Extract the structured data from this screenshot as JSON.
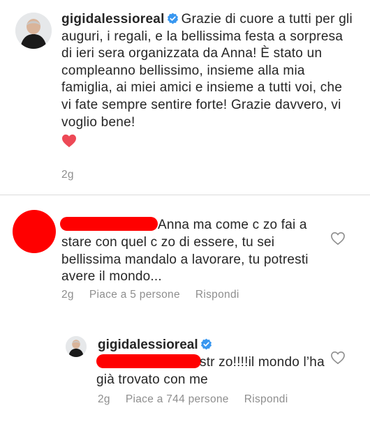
{
  "post": {
    "username": "gigidalessioreal",
    "caption": "Grazie di cuore a tutti per gli auguri, i regali, e la bellissima festa a sorpresa di ieri sera organizzata da Anna! È stato un compleanno bellissimo, insieme alla mia famiglia, ai miei amici e insieme a tutti voi, che vi fate sempre sentire forte! Grazie davvero, vi voglio bene!",
    "heart_emoji": "red-heart-icon",
    "time": "2g"
  },
  "comments": [
    {
      "text": "Anna ma come c    zo fai a stare con quel c    zo di essere, tu sei bellissima mandalo a lavorare, tu potresti  avere il mondo...",
      "time": "2g",
      "likes": "Piace a 5 persone",
      "reply_label": "Rispondi"
    }
  ],
  "reply": {
    "username": "gigidalessioreal",
    "text": "str    zo!!!!il mondo l’ha già trovato con me",
    "time": "2g",
    "likes": "Piace a 744 persone",
    "reply_label": "Rispondi"
  },
  "colors": {
    "text": "#262626",
    "meta": "#8e8e8e",
    "verified": "#3897f0",
    "redaction": "#ff0000",
    "heart": "#ed4956"
  }
}
